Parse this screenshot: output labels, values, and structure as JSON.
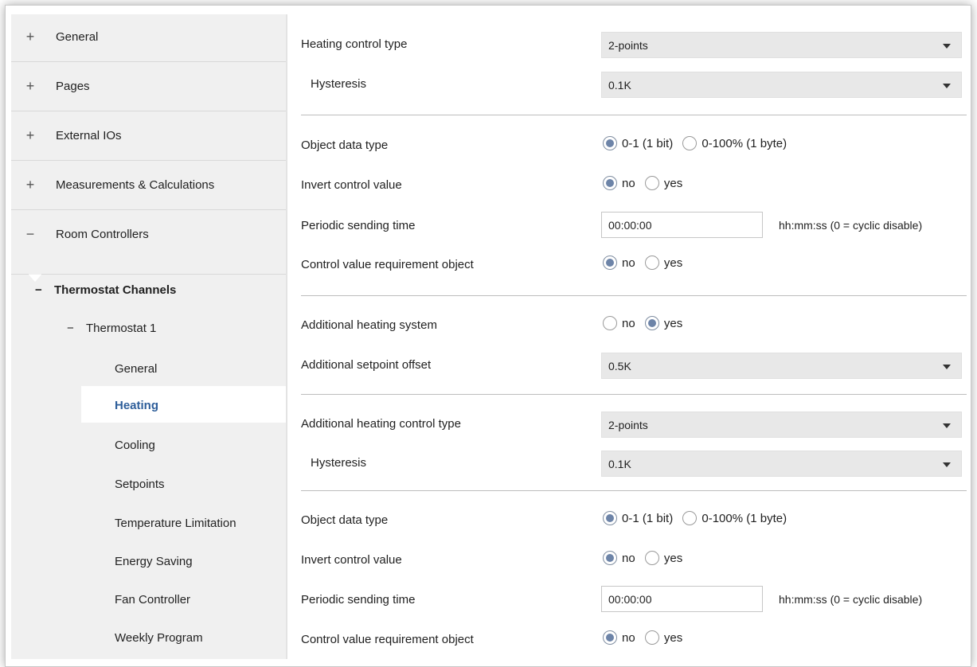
{
  "sidebar": {
    "items": [
      {
        "symbol": "+",
        "label": "General"
      },
      {
        "symbol": "+",
        "label": "Pages"
      },
      {
        "symbol": "+",
        "label": "External IOs"
      },
      {
        "symbol": "+",
        "label": "Measurements & Calculations"
      },
      {
        "symbol": "−",
        "label": "Room Controllers"
      }
    ],
    "tree": {
      "channels_symbol": "−",
      "channels_label": "Thermostat Channels",
      "thermostat_symbol": "−",
      "thermostat_label": "Thermostat 1"
    },
    "subitems": [
      "General",
      "Heating",
      "Cooling",
      "Setpoints",
      "Temperature Limitation",
      "Energy Saving",
      "Fan Controller",
      "Weekly Program"
    ],
    "active_subitem": "Heating"
  },
  "main": {
    "heating_control_type": {
      "label": "Heating control type",
      "value": "2-points"
    },
    "hysteresis1": {
      "label": "Hysteresis",
      "value": "0.1K"
    },
    "object_data_type1": {
      "label": "Object data type",
      "opt1": "0-1 (1 bit)",
      "opt2": "0-100% (1 byte)",
      "selected": "0-1 (1 bit)"
    },
    "invert1": {
      "label": "Invert control value",
      "opt1": "no",
      "opt2": "yes",
      "selected": "no"
    },
    "periodic1": {
      "label": "Periodic sending time",
      "value": "00:00:00",
      "suffix": "hh:mm:ss (0 = cyclic disable)"
    },
    "requirement1": {
      "label": "Control value requirement object",
      "opt1": "no",
      "opt2": "yes",
      "selected": "no"
    },
    "additional_system": {
      "label": "Additional heating system",
      "opt1": "no",
      "opt2": "yes",
      "selected": "yes"
    },
    "additional_offset": {
      "label": "Additional setpoint offset",
      "value": "0.5K"
    },
    "additional_control_type": {
      "label": "Additional heating control type",
      "value": "2-points"
    },
    "hysteresis2": {
      "label": "Hysteresis",
      "value": "0.1K"
    },
    "object_data_type2": {
      "label": "Object data type",
      "opt1": "0-1 (1 bit)",
      "opt2": "0-100% (1 byte)",
      "selected": "0-1 (1 bit)"
    },
    "invert2": {
      "label": "Invert control value",
      "opt1": "no",
      "opt2": "yes",
      "selected": "no"
    },
    "periodic2": {
      "label": "Periodic sending time",
      "value": "00:00:00",
      "suffix": "hh:mm:ss (0 = cyclic disable)"
    },
    "requirement2": {
      "label": "Control value requirement object",
      "opt1": "no",
      "opt2": "yes",
      "selected": "no"
    }
  },
  "colors": {
    "accent": "#2e5e9a",
    "radio_fill": "#6d84a8",
    "sidebar_bg": "#f0f0f0",
    "select_bg": "#e8e8e8"
  }
}
